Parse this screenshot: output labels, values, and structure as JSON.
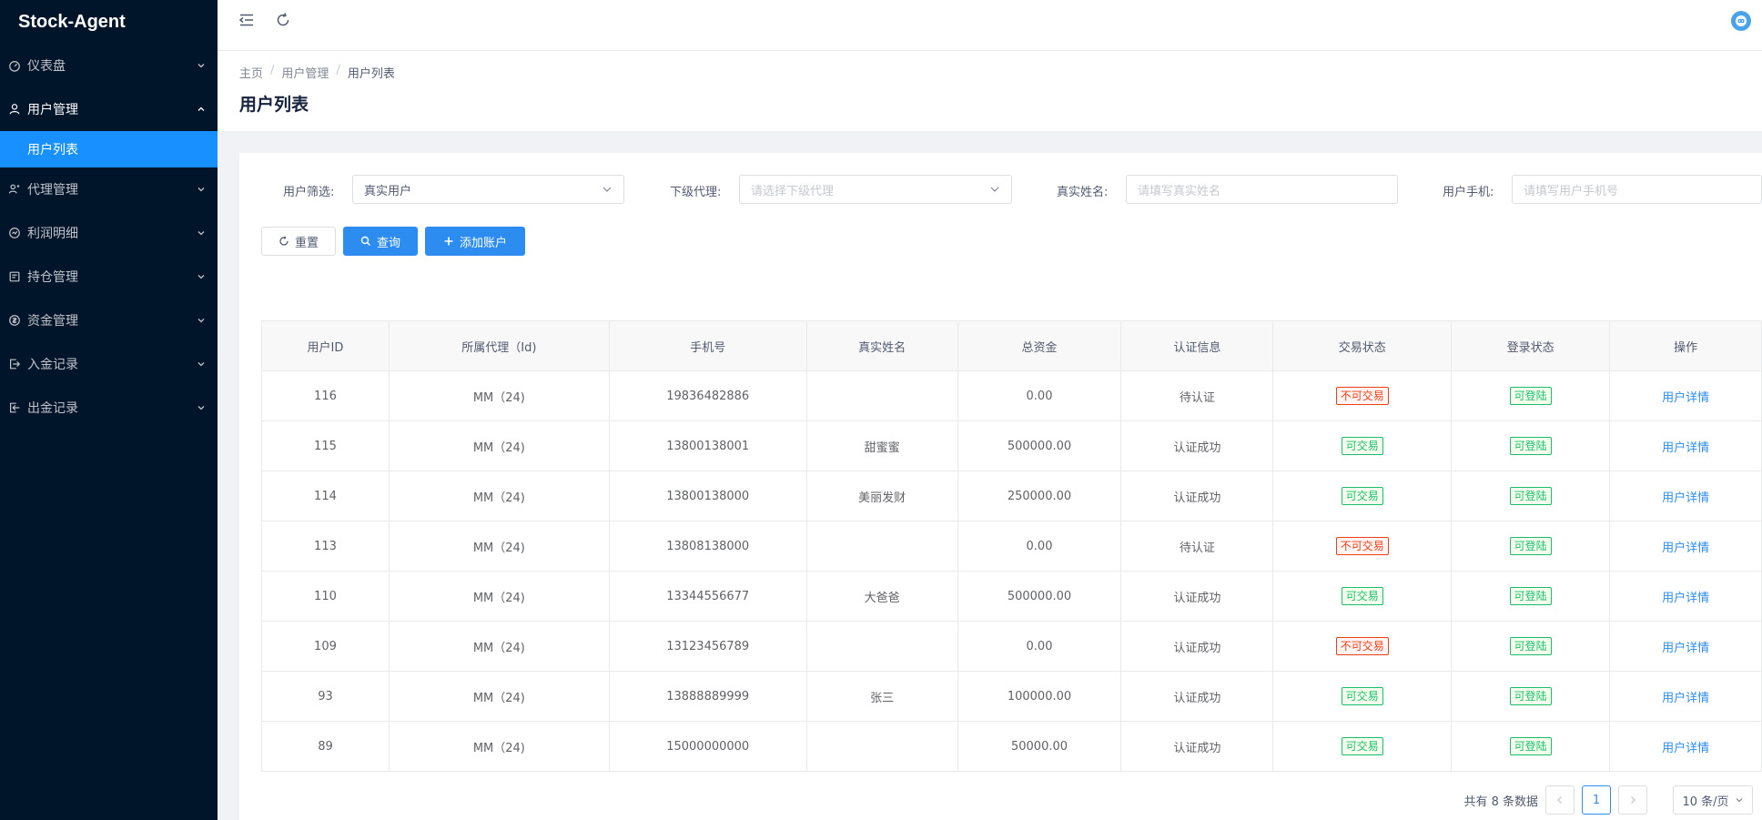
{
  "app": {
    "title": "Stock-Agent"
  },
  "sidebar": {
    "items": [
      {
        "label": "仪表盘",
        "icon": "dashboard-icon"
      },
      {
        "label": "用户管理",
        "icon": "user-icon",
        "open": true,
        "children": [
          {
            "label": "用户列表",
            "active": true
          }
        ]
      },
      {
        "label": "代理管理",
        "icon": "agent-icon"
      },
      {
        "label": "利润明细",
        "icon": "profit-icon"
      },
      {
        "label": "持仓管理",
        "icon": "position-icon"
      },
      {
        "label": "资金管理",
        "icon": "fund-icon"
      },
      {
        "label": "入金记录",
        "icon": "deposit-icon"
      },
      {
        "label": "出金记录",
        "icon": "withdraw-icon"
      }
    ]
  },
  "header": {
    "collapse_icon": "menu-collapse-icon",
    "refresh_icon": "refresh-icon",
    "avatar_icon": "avatar-icon"
  },
  "breadcrumb": [
    "主页",
    "用户管理",
    "用户列表"
  ],
  "page": {
    "title": "用户列表"
  },
  "filters": {
    "user_filter": {
      "label": "用户筛选:",
      "value": "真实用户"
    },
    "sub_agent": {
      "label": "下级代理:",
      "placeholder": "请选择下级代理"
    },
    "real_name": {
      "label": "真实姓名:",
      "placeholder": "请填写真实姓名"
    },
    "user_phone": {
      "label": "用户手机:",
      "placeholder": "请填写用户手机号"
    }
  },
  "buttons": {
    "reset": "重置",
    "query": "查询",
    "add": "添加账户"
  },
  "table": {
    "columns": [
      "用户ID",
      "所属代理（Id)",
      "手机号",
      "真实姓名",
      "总资金",
      "认证信息",
      "交易状态",
      "登录状态",
      "操作"
    ],
    "rows": [
      {
        "id": "116",
        "agent": "MM（24)",
        "phone": "19836482886",
        "name": "",
        "funds": "0.00",
        "auth": "待认证",
        "trade": "不可交易",
        "trade_ok": false,
        "login": "可登陆",
        "action": "用户详情"
      },
      {
        "id": "115",
        "agent": "MM（24)",
        "phone": "13800138001",
        "name": "甜蜜蜜",
        "funds": "500000.00",
        "auth": "认证成功",
        "trade": "可交易",
        "trade_ok": true,
        "login": "可登陆",
        "action": "用户详情"
      },
      {
        "id": "114",
        "agent": "MM（24)",
        "phone": "13800138000",
        "name": "美丽发财",
        "funds": "250000.00",
        "auth": "认证成功",
        "trade": "可交易",
        "trade_ok": true,
        "login": "可登陆",
        "action": "用户详情"
      },
      {
        "id": "113",
        "agent": "MM（24)",
        "phone": "13808138000",
        "name": "",
        "funds": "0.00",
        "auth": "待认证",
        "trade": "不可交易",
        "trade_ok": false,
        "login": "可登陆",
        "action": "用户详情"
      },
      {
        "id": "110",
        "agent": "MM（24)",
        "phone": "13344556677",
        "name": "大爸爸",
        "funds": "500000.00",
        "auth": "认证成功",
        "trade": "可交易",
        "trade_ok": true,
        "login": "可登陆",
        "action": "用户详情"
      },
      {
        "id": "109",
        "agent": "MM（24)",
        "phone": "13123456789",
        "name": "",
        "funds": "0.00",
        "auth": "认证成功",
        "trade": "不可交易",
        "trade_ok": false,
        "login": "可登陆",
        "action": "用户详情"
      },
      {
        "id": "93",
        "agent": "MM（24)",
        "phone": "13888889999",
        "name": "张三",
        "funds": "100000.00",
        "auth": "认证成功",
        "trade": "可交易",
        "trade_ok": true,
        "login": "可登陆",
        "action": "用户详情"
      },
      {
        "id": "89",
        "agent": "MM（24)",
        "phone": "15000000000",
        "name": "",
        "funds": "50000.00",
        "auth": "认证成功",
        "trade": "可交易",
        "trade_ok": true,
        "login": "可登陆",
        "action": "用户详情"
      }
    ]
  },
  "pagination": {
    "total_text": "共有 8 条数据",
    "current_page": "1",
    "page_size": "10 条/页"
  },
  "colors": {
    "sidebar_bg": "#001529",
    "primary": "#2d8cf0",
    "active_menu": "#1890ff",
    "danger": "#ed4014",
    "success": "#19be6b"
  }
}
